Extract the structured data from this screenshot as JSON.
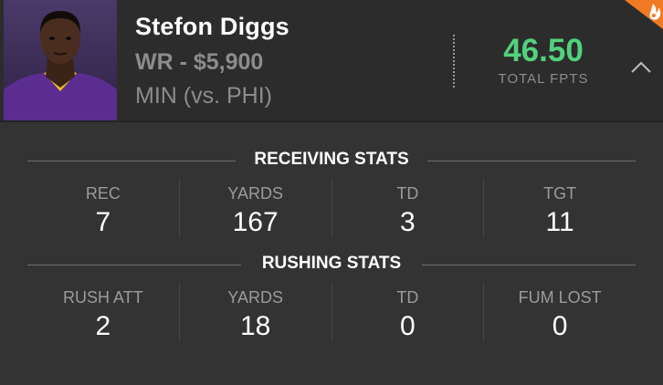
{
  "player": {
    "name": "Stefon Diggs",
    "position_salary": "WR - $5,900",
    "matchup": "MIN (vs. PHI)"
  },
  "score": {
    "value": "46.50",
    "label": "TOTAL FPTS"
  },
  "colors": {
    "accent_green": "#52d17c",
    "hot_badge": "#f07a24",
    "jersey_purple": "#5b2d91"
  },
  "icons": {
    "collapse": "chevron-up-icon",
    "badge": "flame-icon"
  },
  "receiving": {
    "title": "RECEIVING STATS",
    "stats": [
      {
        "label": "REC",
        "value": "7"
      },
      {
        "label": "YARDS",
        "value": "167"
      },
      {
        "label": "TD",
        "value": "3"
      },
      {
        "label": "TGT",
        "value": "11"
      }
    ]
  },
  "rushing": {
    "title": "RUSHING STATS",
    "stats": [
      {
        "label": "RUSH ATT",
        "value": "2"
      },
      {
        "label": "YARDS",
        "value": "18"
      },
      {
        "label": "TD",
        "value": "0"
      },
      {
        "label": "FUM LOST",
        "value": "0"
      }
    ]
  }
}
